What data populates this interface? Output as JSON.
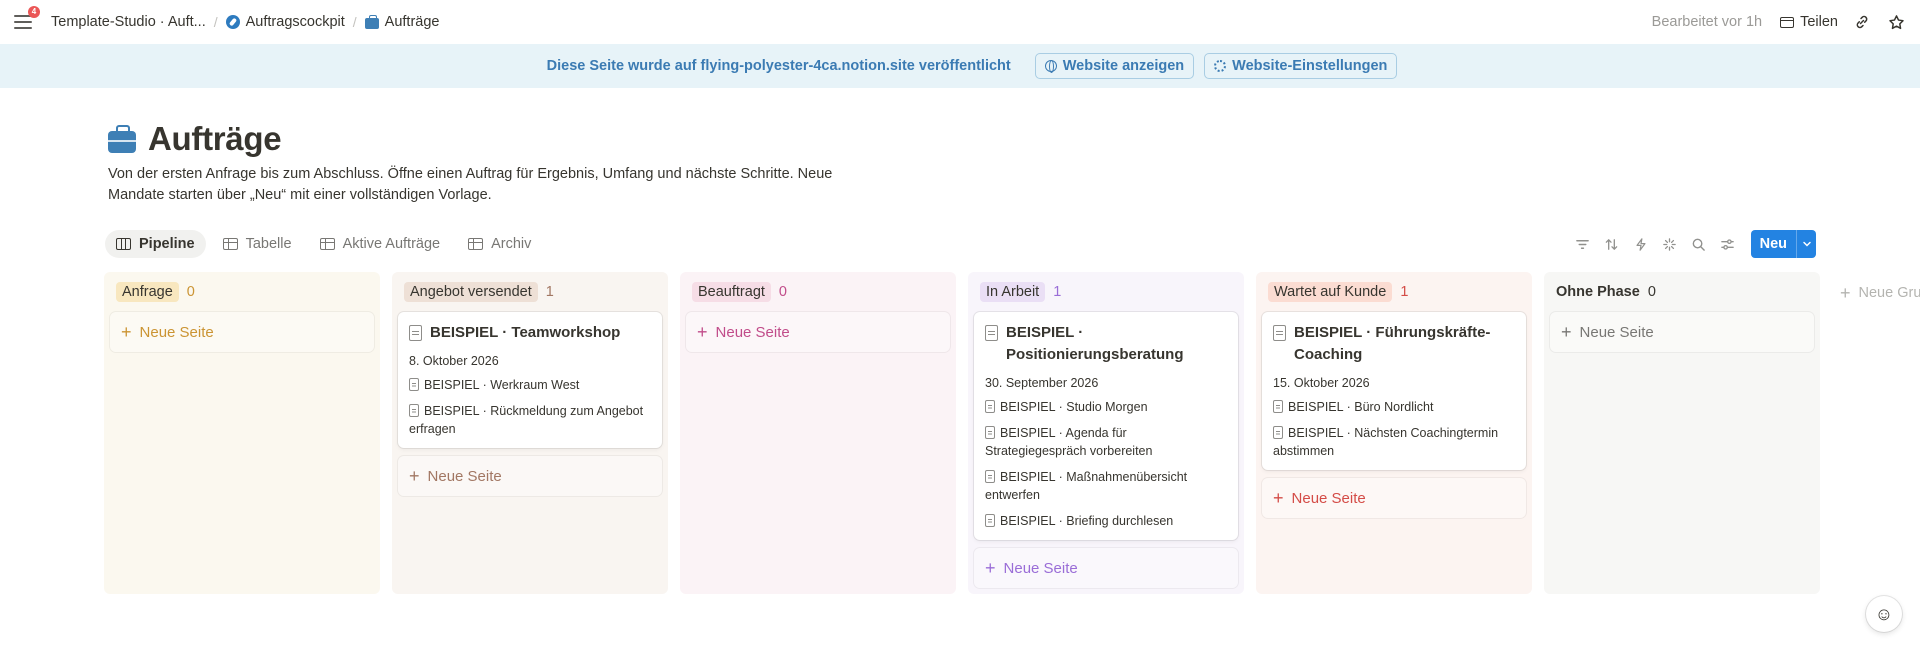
{
  "topbar": {
    "notification_count": "4",
    "breadcrumbs": [
      "Template-Studio · Auft...",
      "Auftragscockpit",
      "Aufträge"
    ],
    "edited": "Bearbeitet vor 1h",
    "share_label": "Teilen"
  },
  "banner": {
    "text": "Diese Seite wurde auf flying-polyester-4ca.notion.site veröffentlicht",
    "view_site": "Website anzeigen",
    "site_settings": "Website-Einstellungen"
  },
  "page": {
    "title": "Aufträge",
    "description": "Von der ersten Anfrage bis zum Abschluss. Öffne einen Auftrag für Ergebnis, Umfang und nächste Schritte. Neue Mandate starten über „Neu“ mit einer vollständigen Vorlage."
  },
  "views": [
    {
      "label": "Pipeline",
      "icon": "board-icon"
    },
    {
      "label": "Tabelle",
      "icon": "table-icon"
    },
    {
      "label": "Aktive Aufträge",
      "icon": "table-icon"
    },
    {
      "label": "Archiv",
      "icon": "table-icon"
    }
  ],
  "toolbar": {
    "new_label": "Neu"
  },
  "add_page_label": "Neue Seite",
  "add_group_label": "Neue Gru",
  "columns": [
    {
      "name": "Anfrage",
      "count": "0",
      "colors": {
        "bg": "#fbf8ef",
        "pill": "#f8e7bf",
        "text": "#cb9433"
      },
      "cards": []
    },
    {
      "name": "Angebot versendet",
      "count": "1",
      "colors": {
        "bg": "#f9f5f1",
        "pill": "#eee0d6",
        "text": "#a27763"
      },
      "cards": [
        {
          "title": "BEISPIEL · Teamworkshop",
          "date": "8. Oktober 2026",
          "relations": [
            "BEISPIEL · Werkraum West",
            "BEISPIEL · Rückmeldung zum Angebot erfragen"
          ]
        }
      ]
    },
    {
      "name": "Beauftragt",
      "count": "0",
      "colors": {
        "bg": "#fbf3f6",
        "pill": "#f6dde6",
        "text": "#c14c8a"
      },
      "cards": []
    },
    {
      "name": "In Arbeit",
      "count": "1",
      "colors": {
        "bg": "#f8f5fb",
        "pill": "#eadff5",
        "text": "#9a6dd7"
      },
      "cards": [
        {
          "title": "BEISPIEL · Positionierungsberatung",
          "date": "30. September 2026",
          "relations": [
            "BEISPIEL · Studio Morgen",
            "BEISPIEL · Agenda für Strategiegespräch vorbereiten",
            "BEISPIEL · Maßnahmenübersicht entwerfen",
            "BEISPIEL · Briefing durchlesen"
          ]
        }
      ]
    },
    {
      "name": "Wartet auf Kunde",
      "count": "1",
      "colors": {
        "bg": "#fcf4f1",
        "pill": "#fbdcd2",
        "text": "#d44c47"
      },
      "cards": [
        {
          "title": "BEISPIEL · Führungskräfte-Coaching",
          "date": "15. Oktober 2026",
          "relations": [
            "BEISPIEL · Büro Nordlicht",
            "BEISPIEL · Nächsten Coachingtermin abstimmen"
          ]
        }
      ]
    },
    {
      "name": "Ohne Phase",
      "count": "0",
      "colors": {
        "bg": "#f7f7f5",
        "pill": "transparent",
        "text": "#787774"
      },
      "cards": []
    }
  ]
}
